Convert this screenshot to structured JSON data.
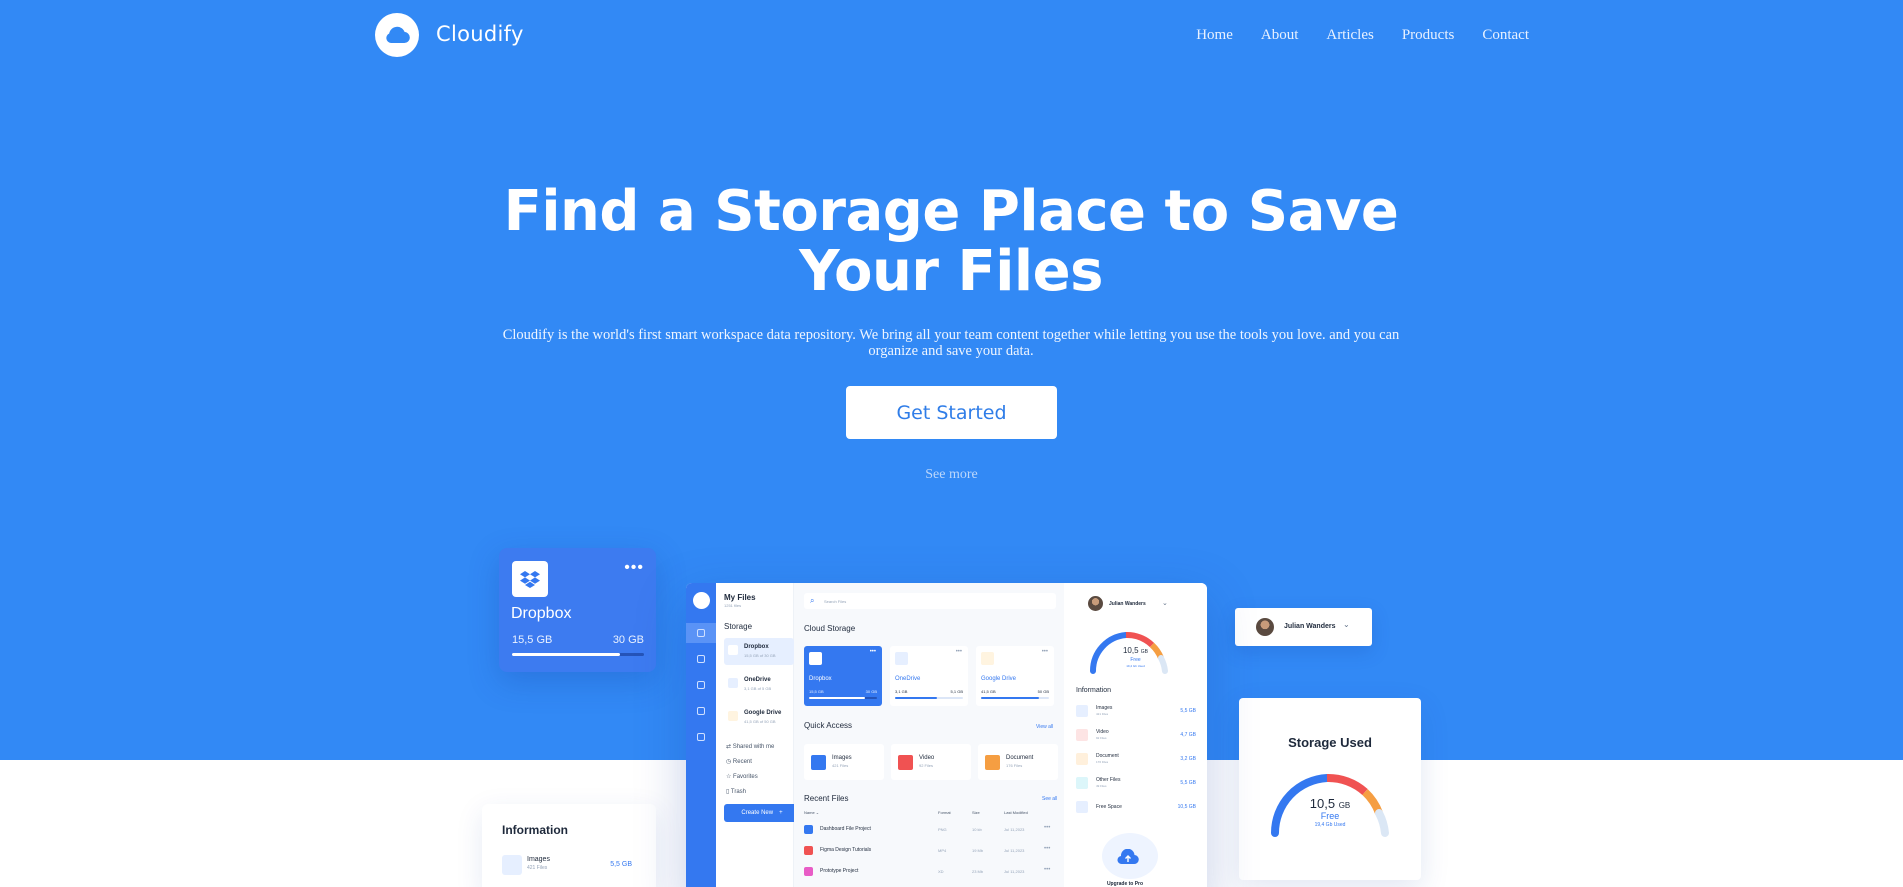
{
  "brand": {
    "name": "Cloudify",
    "logo_icon": "cloud-icon",
    "color_primary": "#3289f5"
  },
  "nav": {
    "items": [
      "Home",
      "About",
      "Articles",
      "Products",
      "Contact"
    ]
  },
  "hero": {
    "title": "Find a Storage Place to Save Your Files",
    "subtitle": "Cloudify is the world's first smart workspace data repository. We bring all your team content together while letting you use the tools you love. and you can organize and save your data.",
    "cta": "Get Started",
    "see_more": "See more"
  },
  "dropbox_card": {
    "name": "Dropbox",
    "used": "15,5 GB",
    "total": "30 GB",
    "progress": 0.82,
    "menu_icon": "more-dots-icon"
  },
  "user_card": {
    "name": "Julian Wanders"
  },
  "storage_card": {
    "title": "Storage Used",
    "value": "10,5",
    "unit": "GB",
    "free_label": "Free",
    "used_label": "19,4 Gb Used"
  },
  "info_card": {
    "title": "Information",
    "row_label": "Images",
    "row_sub": "421 Files",
    "row_size": "5,5 GB"
  },
  "dashboard": {
    "sidebar": {
      "title": "My Files",
      "subtitle": "1251 files",
      "storage_heading": "Storage",
      "storage_items": [
        {
          "label": "Dropbox",
          "sub": "15,5 GB of 30 GB"
        },
        {
          "label": "OneDrive",
          "sub": "3,1 GB of 5 GB"
        },
        {
          "label": "Google Drive",
          "sub": "41,5 GB of 50 GB"
        }
      ],
      "links": [
        "Shared with me",
        "Recent",
        "Favorites",
        "Trash"
      ],
      "create_button": "Create New"
    },
    "search_placeholder": "Search Files",
    "cloud_storage_heading": "Cloud Storage",
    "clouds": [
      {
        "name": "Dropbox",
        "used": "15,5 GB",
        "total": "30 GB",
        "progress": 0.82
      },
      {
        "name": "OneDrive",
        "used": "3,1 GB",
        "total": "5,1 GB",
        "progress": 0.62
      },
      {
        "name": "Google Drive",
        "used": "41,5 GB",
        "total": "50 GB",
        "progress": 0.85
      }
    ],
    "quick_access_heading": "Quick Access",
    "view_all": "View all",
    "quick_access": [
      {
        "label": "Images",
        "sub": "421 Files",
        "color": "#3478f0"
      },
      {
        "label": "Video",
        "sub": "92 Files",
        "color": "#f05252"
      },
      {
        "label": "Document",
        "sub": "176 Files",
        "color": "#f59e42"
      }
    ],
    "recent_heading": "Recent Files",
    "see_all": "See all",
    "table_headers": [
      "Name",
      "Format",
      "Size",
      "Last Modified"
    ],
    "recent_files": [
      {
        "name": "Dashboard File Project",
        "format": "PNG",
        "size": "10 kb",
        "date": "Jul 11,2023",
        "color": "#3478f0"
      },
      {
        "name": "Figma Design Tutorials",
        "format": "MP4",
        "size": "19 Mb",
        "date": "Jul 11,2023",
        "color": "#f05252"
      },
      {
        "name": "Prototype Project",
        "format": "XD",
        "size": "23 Mb",
        "date": "Jul 11,2023",
        "color": "#e85cc6"
      }
    ],
    "right": {
      "user": "Julian Wanders",
      "gauge_value": "10,5",
      "gauge_unit": "GB",
      "gauge_free": "Free",
      "gauge_used": "19,4 Gb Used",
      "info_heading": "Information",
      "info": [
        {
          "label": "Images",
          "sub": "421 Files",
          "size": "5,5 GB",
          "color": "#3478f0"
        },
        {
          "label": "Video",
          "sub": "92 Files",
          "size": "4,7 GB",
          "color": "#f05252"
        },
        {
          "label": "Document",
          "sub": "176 Files",
          "size": "3,2 GB",
          "color": "#f59e42"
        },
        {
          "label": "Other Files",
          "sub": "49 Files",
          "size": "5,5 GB",
          "color": "#22b8cf"
        },
        {
          "label": "Free Space",
          "sub": "",
          "size": "10,5 GB",
          "color": "#3478f0"
        }
      ],
      "upgrade": "Upgrade to Pro"
    }
  }
}
